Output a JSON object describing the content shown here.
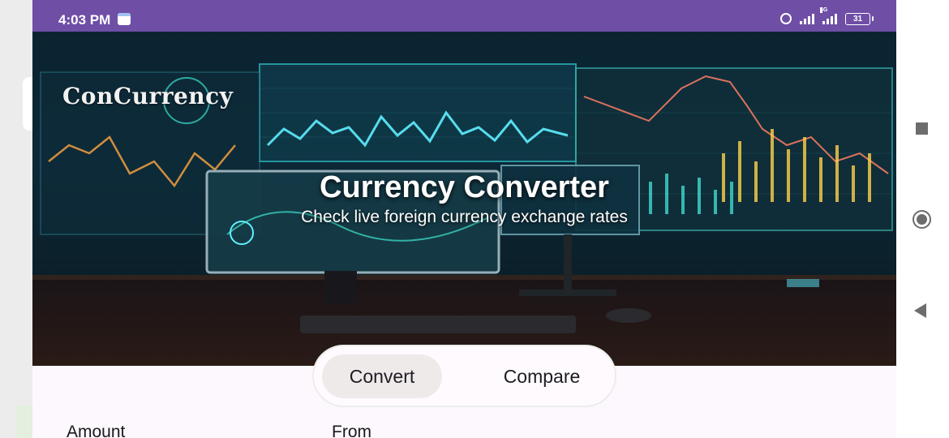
{
  "status_bar": {
    "time": "4:03 PM",
    "network_label": "4G",
    "battery_level": "31",
    "icons": [
      "calendar-icon",
      "alarm-icon",
      "signal-icon",
      "4g-signal-icon",
      "battery-icon"
    ]
  },
  "header": {
    "app_name": "ConCurrency",
    "title": "Currency Converter",
    "subtitle": "Check live foreign currency exchange rates"
  },
  "tabs": [
    {
      "label": "Convert",
      "selected": true
    },
    {
      "label": "Compare",
      "selected": false
    }
  ],
  "form": {
    "amount_label": "Amount",
    "from_label": "From"
  },
  "nav_bar": {
    "buttons": [
      "recent-apps-icon",
      "home-icon",
      "back-icon"
    ]
  },
  "colors": {
    "status_bar": "#6f4ea6",
    "selected_tab": "#eeeae9",
    "page_background": "#fcf8fd",
    "nav_icon": "#6d6d6d"
  }
}
